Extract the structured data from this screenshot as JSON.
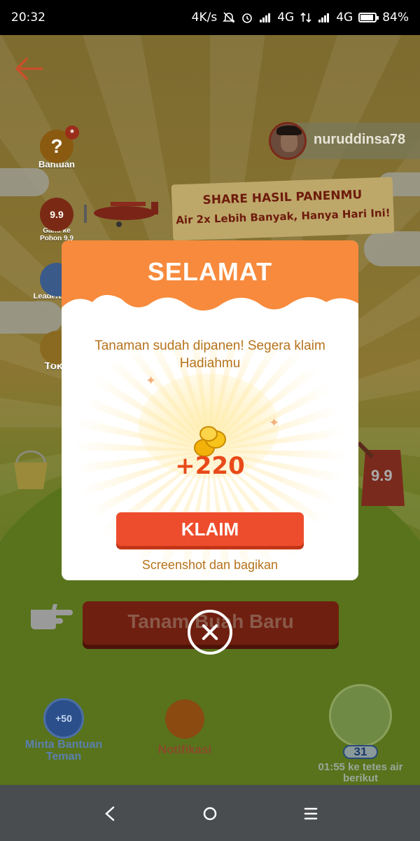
{
  "status_bar": {
    "time": "20:32",
    "speed": "4K/s",
    "net1": "4G",
    "net2": "4G",
    "battery": "84%"
  },
  "sidebar": {
    "items": [
      {
        "label": "Bantuan",
        "icon": "question-icon"
      },
      {
        "label": "Ganti ke Pohon 9.9",
        "icon": "tree-bag-icon",
        "badge": "9.9"
      },
      {
        "label": "Leaderboard",
        "icon": "leaderboard-icon"
      },
      {
        "label": "Toko",
        "icon": "shop-icon"
      }
    ]
  },
  "user": {
    "username": "nuruddinsa78"
  },
  "banner": {
    "line1": "SHARE HASIL PANENMU",
    "line2": "Air 2x Lebih Banyak, Hanya Hari Ini!"
  },
  "watering_can": {
    "badge": "9.9"
  },
  "main": {
    "plant_button": "Tanam Buah Baru"
  },
  "bottom": {
    "help_badge": "+50",
    "help_label": "Minta Bantuan Teman",
    "notif_label": "Notifikasi",
    "water_count": "31",
    "water_timer": "01:55 ke tetes air berikut"
  },
  "modal": {
    "title": "SELAMAT",
    "message": "Tanaman sudah dipanen! Segera klaim Hadiahmu",
    "reward": "+220",
    "claim_button": "KLAIM",
    "share_link": "Screenshot dan bagikan"
  },
  "colors": {
    "accent": "#ee4d2d",
    "header": "#f78a3c",
    "text_gold": "#b5731c",
    "reward": "#e84a1a"
  }
}
